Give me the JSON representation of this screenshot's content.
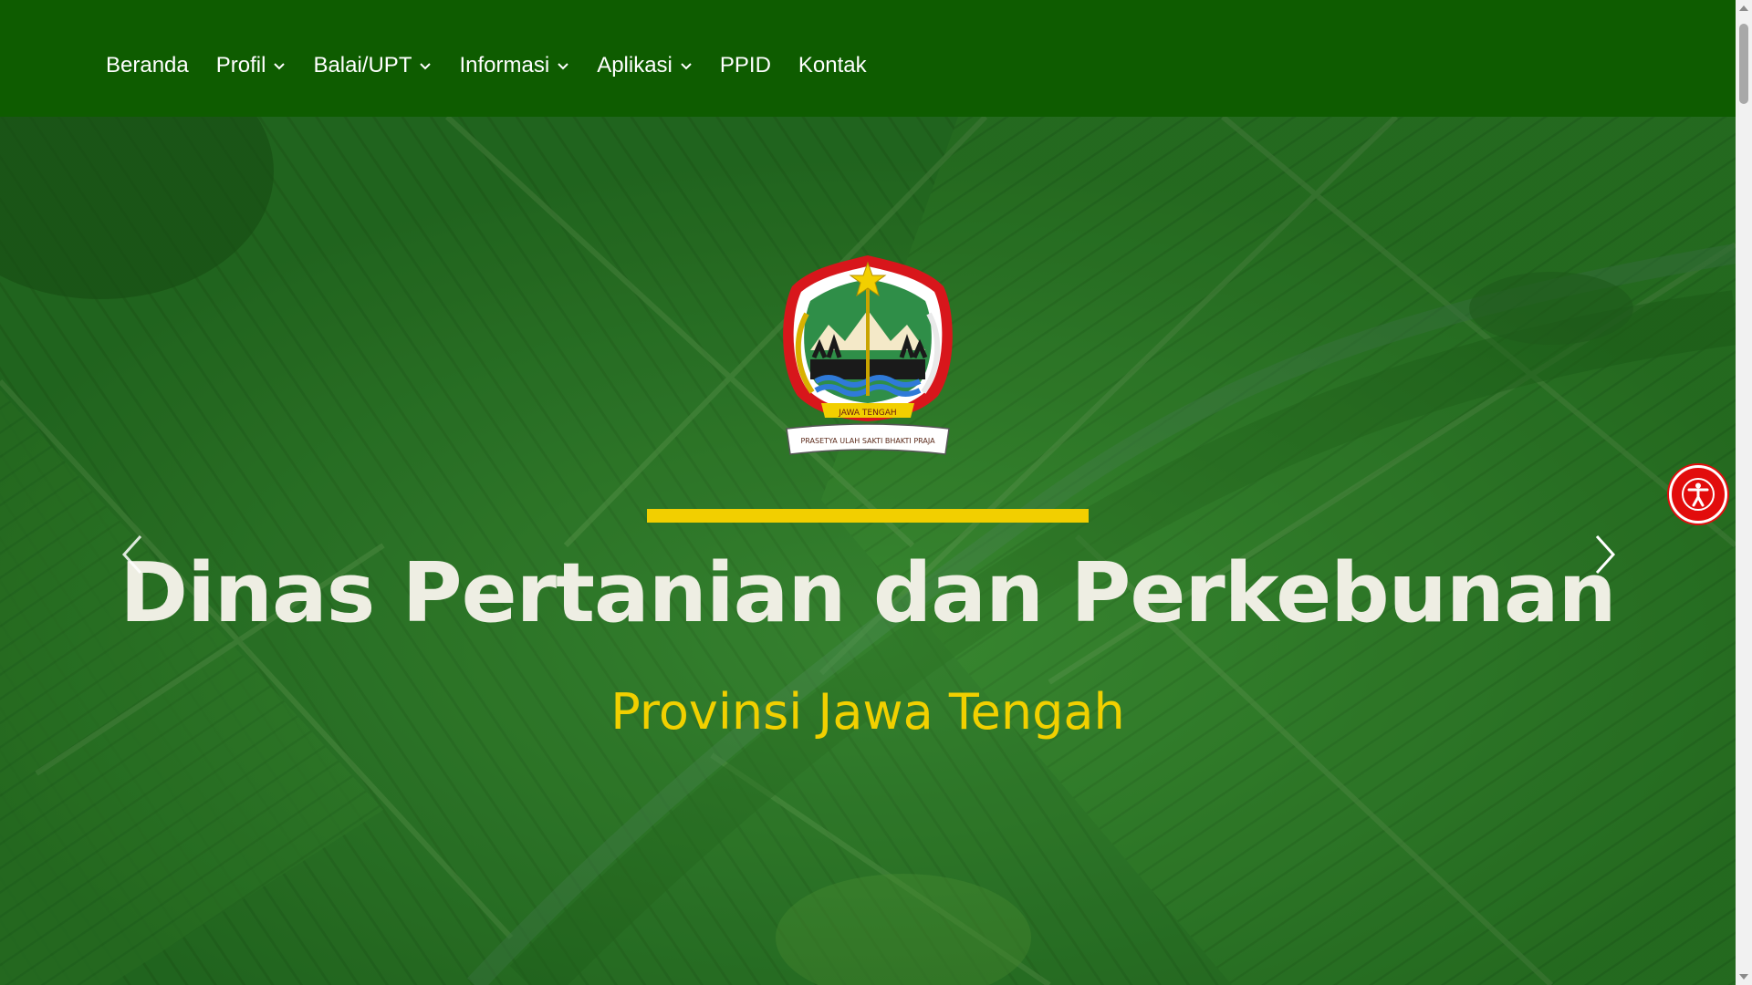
{
  "nav": {
    "items": [
      {
        "label": "Beranda",
        "dropdown": false
      },
      {
        "label": "Profil",
        "dropdown": true
      },
      {
        "label": "Balai/UPT",
        "dropdown": true
      },
      {
        "label": "Informasi",
        "dropdown": true
      },
      {
        "label": "Aplikasi",
        "dropdown": true
      },
      {
        "label": "PPID",
        "dropdown": false
      },
      {
        "label": "Kontak",
        "dropdown": false
      }
    ]
  },
  "hero": {
    "title": "Dinas Pertanian dan Perkebunan",
    "subtitle": "Provinsi Jawa Tengah",
    "emblem": {
      "top_text": "JAWA TENGAH",
      "ribbon_text": "PRASETYA ULAH SAKTI BHAKTI PRAJA"
    }
  },
  "colors": {
    "nav_bg": "#0e5c00",
    "accent_yellow": "#f2cf00",
    "title_text": "#eeeee3",
    "a11y_red": "#e20c0c"
  },
  "icons": {
    "prev": "chevron-left-icon",
    "next": "chevron-right-icon",
    "accessibility": "accessibility-icon"
  }
}
